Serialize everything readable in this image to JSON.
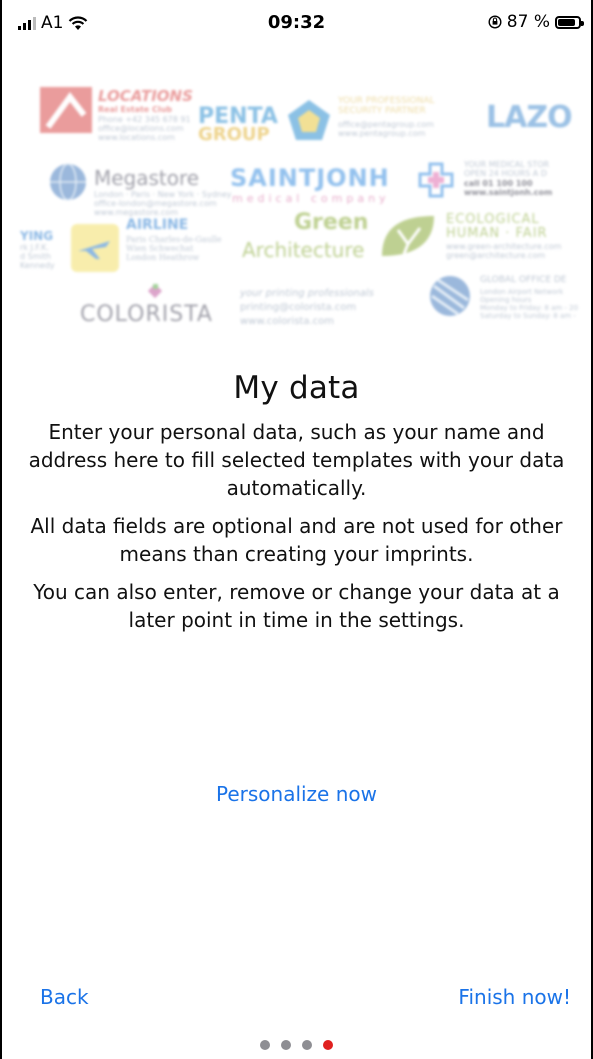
{
  "status": {
    "carrier": "A1",
    "time": "09:32",
    "battery": "87 %",
    "battery_level": 0.87
  },
  "logos": {
    "locations": {
      "name": "LOCATIONS",
      "sub": "Real Estate Club",
      "line1": "Phone +42 345 678 91",
      "line2": "office@locations.com",
      "line3": "www.locations.com"
    },
    "penta": {
      "name1": "PENTA",
      "name2": "GROUP",
      "tag": "YOUR PROFESSIONAL SECURITY PARTNER",
      "line1": "office@pentagroup.com",
      "line2": "www.pentagroup.com"
    },
    "lazo": {
      "name": "LAZO"
    },
    "megastore": {
      "name": "Megastore",
      "line1": "London · Paris · New York · Sydney",
      "line2": "office-london@megastore.com",
      "line3": "www.megastore.com"
    },
    "saintjonh": {
      "name": "SAINTJONH",
      "sub": "medical company",
      "line1": "YOUR MEDICAL STOR",
      "line2": "OPEN 24 HOURS A D",
      "line3": "call 01 100 100",
      "line4": "www.saintjonh.com"
    },
    "green": {
      "name1": "Green",
      "name2": "Architecture",
      "tag1": "ECOLOGICAL",
      "tag2": "HUMAN · FAIR",
      "line1": "www.green-architecture.com",
      "line2": "green@architecture.com"
    },
    "airline": {
      "left1": "YING",
      "left2": "rk J.F.K.",
      "left3": "d Smith",
      "left4": "Kennedy",
      "name": "AIRLINE",
      "line1": "Paris Charles-de-Gaulle",
      "line2": "Wien Schwechat",
      "line3": "London Heathrow"
    },
    "colorista": {
      "name": "COLORISTA",
      "line1": "your printing professionals",
      "line2": "printing@colorista.com",
      "line3": "www.colorista.com"
    },
    "global": {
      "name": "GLOBAL OFFICE DE",
      "line1": "London Airport Network",
      "line2": "Opening hours",
      "line3": "Monday to Friday: 8 am - 20",
      "line4": "Saturday to Sunday: 8 am -"
    }
  },
  "main": {
    "title": "My data",
    "paragraphs": [
      "Enter your personal data, such as your name and address here to fill selected templates with your data automatically.",
      "All data fields are optional and are not used for other means than creating your imprints.",
      "You can also enter, remove or change your data at a later point in time in the settings."
    ]
  },
  "actions": {
    "personalize": "Personalize now",
    "back": "Back",
    "finish": "Finish now!"
  },
  "pager": {
    "count": 4,
    "active": 4
  }
}
